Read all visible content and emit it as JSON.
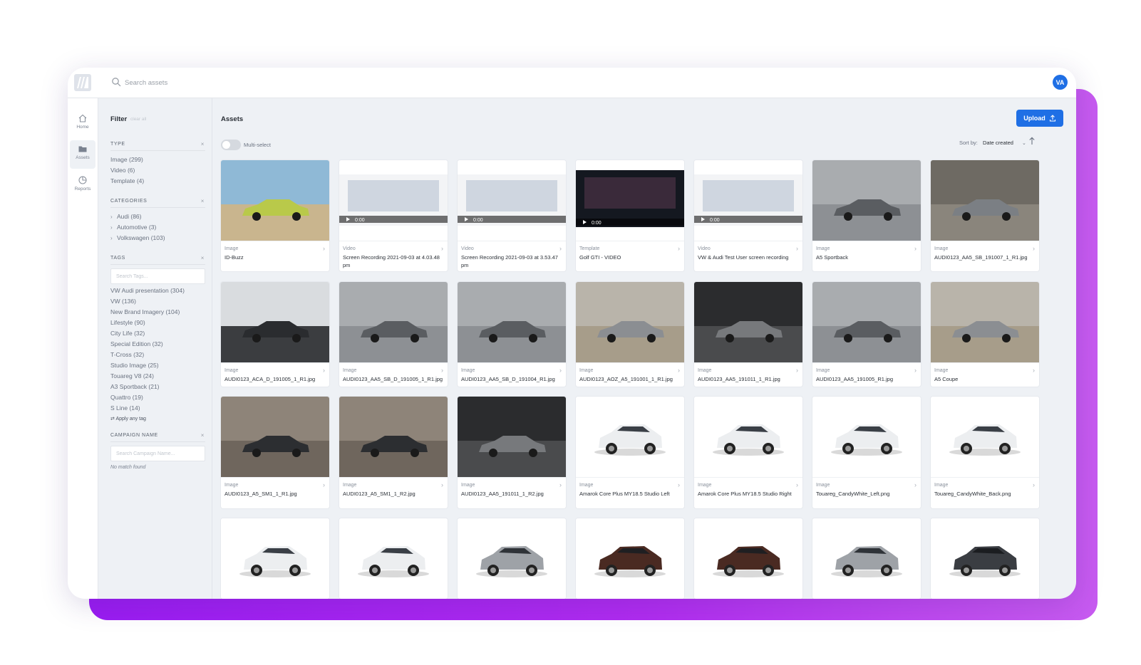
{
  "topbar": {
    "search_placeholder": "Search assets",
    "avatar_initials": "VA"
  },
  "nav": [
    {
      "label": "Home",
      "icon": "home-icon"
    },
    {
      "label": "Assets",
      "icon": "folder-icon"
    },
    {
      "label": "Reports",
      "icon": "pie-chart-icon"
    }
  ],
  "filter": {
    "title": "Filter",
    "clear_all": "clear all",
    "type": {
      "heading": "Type",
      "options": [
        "Image (299)",
        "Video (6)",
        "Template (4)"
      ]
    },
    "categories": {
      "heading": "Categories",
      "options": [
        "Audi (86)",
        "Automotive (3)",
        "Volkswagen (103)"
      ]
    },
    "tags": {
      "heading": "Tags",
      "placeholder": "Search Tags...",
      "options": [
        "VW Audi presentation (304)",
        "VW (136)",
        "New Brand Imagery (104)",
        "Lifestyle (90)",
        "City Life (32)",
        "Special Edition (32)",
        "T-Cross (32)",
        "Studio Image (25)",
        "Touareg V8 (24)",
        "A3 Sportback (21)",
        "Quattro (19)",
        "S Line (14)"
      ],
      "apply_label": "Apply any tag"
    },
    "campaign": {
      "heading": "Campaign name",
      "placeholder": "Search Campaign Name...",
      "no_match": "No match found"
    }
  },
  "main": {
    "title": "Assets",
    "upload_label": "Upload",
    "multiselect_label": "Multi-select",
    "sort_label": "Sort by:",
    "sort_value": "Date created"
  },
  "colors": {
    "accent": "#1f6fe5",
    "purple_backdrop": "#9a1cf2"
  },
  "assets": [
    {
      "type": "Image",
      "name": "ID-Buzz",
      "thumb": "photo-van"
    },
    {
      "type": "Video",
      "name": "Screen Recording 2021-09-03 at 4.03.48 pm",
      "thumb": "video-light",
      "time": "0:00"
    },
    {
      "type": "Video",
      "name": "Screen Recording 2021-09-03 at 3.53.47 pm",
      "thumb": "video-light",
      "time": "0:00"
    },
    {
      "type": "Template",
      "name": "Golf GTI - VIDEO",
      "thumb": "video-dark",
      "time": "0:00"
    },
    {
      "type": "Video",
      "name": "VW & Audi Test User screen recording",
      "thumb": "video-light",
      "time": "0:00"
    },
    {
      "type": "Image",
      "name": "A5 Sportback",
      "thumb": "photo-gray"
    },
    {
      "type": "Image",
      "name": "AUDI0123_AA5_SB_191007_1_R1.jpg",
      "thumb": "photo-tunnel"
    },
    {
      "type": "Image",
      "name": "AUDI0123_ACA_D_191005_1_R1.jpg",
      "thumb": "photo-interior"
    },
    {
      "type": "Image",
      "name": "AUDI0123_AA5_SB_D_191005_1_R1.jpg",
      "thumb": "photo-gray"
    },
    {
      "type": "Image",
      "name": "AUDI0123_AA5_SB_D_191004_R1.jpg",
      "thumb": "photo-gray"
    },
    {
      "type": "Image",
      "name": "AUDI0123_AOZ_A5_191001_1_R1.jpg",
      "thumb": "photo-beige"
    },
    {
      "type": "Image",
      "name": "AUDI0123_AA5_191011_1_R1.jpg",
      "thumb": "photo-dark"
    },
    {
      "type": "Image",
      "name": "AUDI0123_AA5_191005_R1.jpg",
      "thumb": "photo-gray"
    },
    {
      "type": "Image",
      "name": "A5 Coupe",
      "thumb": "photo-beige"
    },
    {
      "type": "Image",
      "name": "AUDI0123_A5_SM1_1_R1.jpg",
      "thumb": "photo-brown"
    },
    {
      "type": "Image",
      "name": "AUDI0123_A5_SM1_1_R2.jpg",
      "thumb": "photo-brown"
    },
    {
      "type": "Image",
      "name": "AUDI0123_AA5_191011_1_R2.jpg",
      "thumb": "photo-dark"
    },
    {
      "type": "Image",
      "name": "Amarok Core Plus MY18.5 Studio Left",
      "thumb": "studio-white"
    },
    {
      "type": "Image",
      "name": "Amarok Core Plus MY18.5 Studio Right",
      "thumb": "studio-white"
    },
    {
      "type": "Image",
      "name": "Touareg_CandyWhite_Left.png",
      "thumb": "studio-white"
    },
    {
      "type": "Image",
      "name": "Touareg_CandyWhite_Back.png",
      "thumb": "studio-white"
    },
    {
      "type": "",
      "name": "",
      "thumb": "studio-white"
    },
    {
      "type": "",
      "name": "",
      "thumb": "studio-white"
    },
    {
      "type": "",
      "name": "",
      "thumb": "studio-silver"
    },
    {
      "type": "",
      "name": "",
      "thumb": "studio-brown"
    },
    {
      "type": "",
      "name": "",
      "thumb": "studio-brown"
    },
    {
      "type": "",
      "name": "",
      "thumb": "studio-silver"
    },
    {
      "type": "",
      "name": "",
      "thumb": "studio-dark"
    }
  ]
}
